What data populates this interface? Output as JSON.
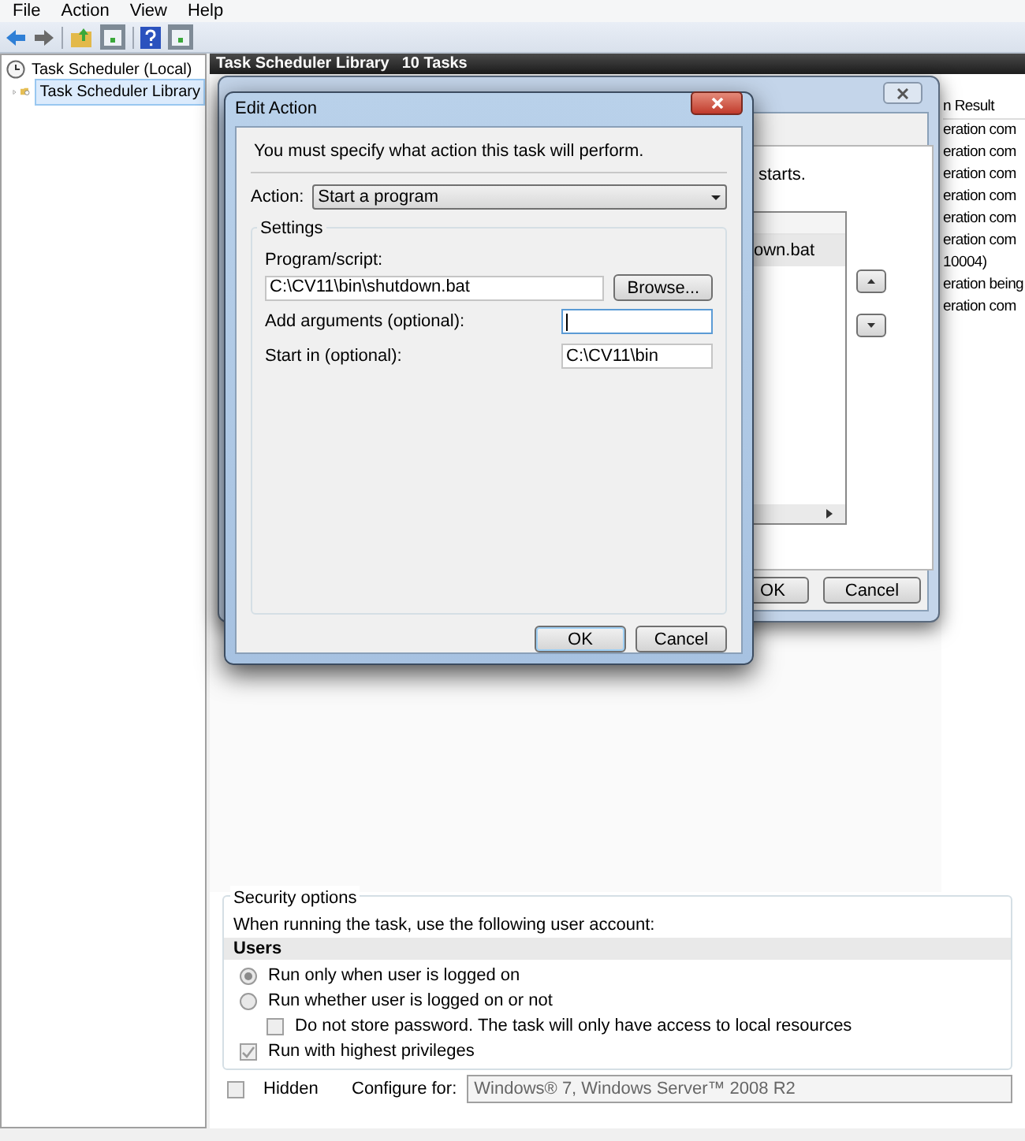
{
  "menu": [
    "File",
    "Action",
    "View",
    "Help"
  ],
  "tree": [
    {
      "label": "Task Scheduler (Local)",
      "selected": false,
      "children": [
        {
          "label": "Task Scheduler Library",
          "selected": true,
          "expanded": false
        }
      ]
    }
  ],
  "library_header": {
    "title": "Task Scheduler Library",
    "count": "10 Tasks"
  },
  "results_column": {
    "header": "n Result",
    "rows": [
      "eration com",
      "eration com",
      "eration com",
      "eration com",
      "eration com",
      "eration com",
      "10004)",
      "eration being",
      "eration com"
    ]
  },
  "task_properties": {
    "text_fragment": "starts.",
    "actions_list": [
      {
        "text": "own.bat",
        "selected": true
      }
    ],
    "buttons": [
      "OK",
      "Cancel"
    ]
  },
  "security": {
    "title": "Security options",
    "account_label": "When running the task, use the following user account:",
    "account": "Users",
    "options": [
      {
        "kind": "radio",
        "label": "Run only when user is logged on",
        "checked": true
      },
      {
        "kind": "radio",
        "label": "Run whether user is logged on or not",
        "checked": false,
        "children": [
          {
            "kind": "checkbox",
            "label": "Do not store password.  The task will only have access to local resources",
            "checked": false
          }
        ]
      },
      {
        "kind": "checkbox",
        "label": "Run with highest privileges",
        "checked": true
      }
    ]
  },
  "hidden": {
    "label": "Hidden",
    "checked": false
  },
  "configure": {
    "label": "Configure for:",
    "value": "Windows® 7, Windows Server™ 2008 R2"
  },
  "edit_action": {
    "title": "Edit Action",
    "instruction": "You must specify what action this task will perform.",
    "action": {
      "label": "Action:",
      "value": "Start a program"
    },
    "settings": {
      "title": "Settings",
      "program": {
        "label": "Program/script:",
        "value": "C:\\CV11\\bin\\shutdown.bat",
        "browse": "Browse..."
      },
      "arguments": {
        "label": "Add arguments (optional):",
        "focused": true
      },
      "start_in": {
        "label": "Start in (optional):",
        "value": "C:\\CV11\\bin"
      }
    },
    "buttons": [
      {
        "label": "OK",
        "default": true
      },
      {
        "label": "Cancel",
        "default": false
      }
    ]
  }
}
